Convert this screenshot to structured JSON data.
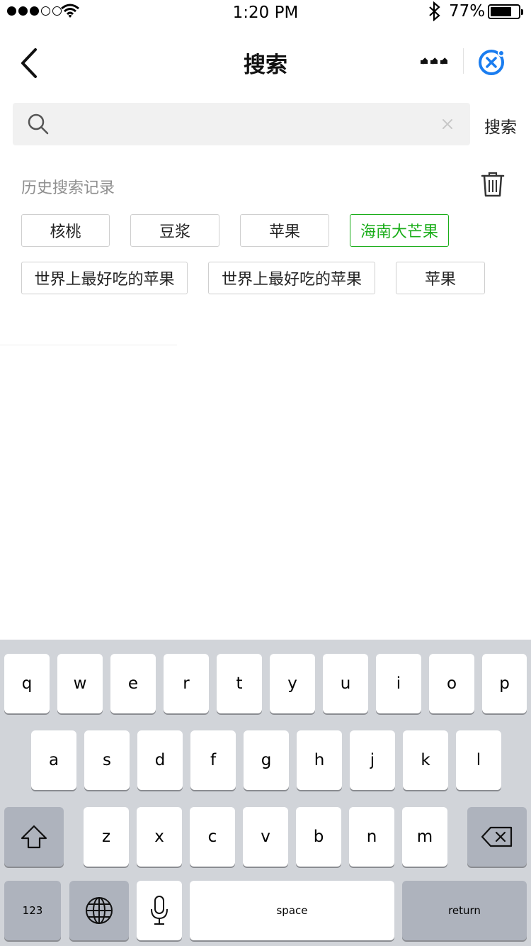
{
  "status_bar": {
    "time": "1:20 PM",
    "battery_percent_text": "77%",
    "battery_level": 0.77,
    "signal_bars_filled": 3,
    "signal_bars_total": 5
  },
  "nav": {
    "title": "搜索"
  },
  "search": {
    "placeholder": "",
    "value": "",
    "button_label": "搜索"
  },
  "history": {
    "title": "历史搜索记录",
    "tags": [
      {
        "label": "核桃"
      },
      {
        "label": "豆浆"
      },
      {
        "label": "苹果"
      },
      {
        "label": "海南大芒果",
        "active": true
      },
      {
        "label": "世界上最好吃的苹果"
      },
      {
        "label": "世界上最好吃的苹果"
      },
      {
        "label": "苹果"
      }
    ]
  },
  "keyboard": {
    "row1": [
      "q",
      "w",
      "e",
      "r",
      "t",
      "y",
      "u",
      "i",
      "o",
      "p"
    ],
    "row2": [
      "a",
      "s",
      "d",
      "f",
      "g",
      "h",
      "j",
      "k",
      "l"
    ],
    "row3": [
      "z",
      "x",
      "c",
      "v",
      "b",
      "n",
      "m"
    ],
    "numbers_label": "123",
    "space_label": "space",
    "return_label": "return"
  },
  "colors": {
    "accent_green": "#1aad19",
    "close_icon_blue": "#1a7df0"
  }
}
